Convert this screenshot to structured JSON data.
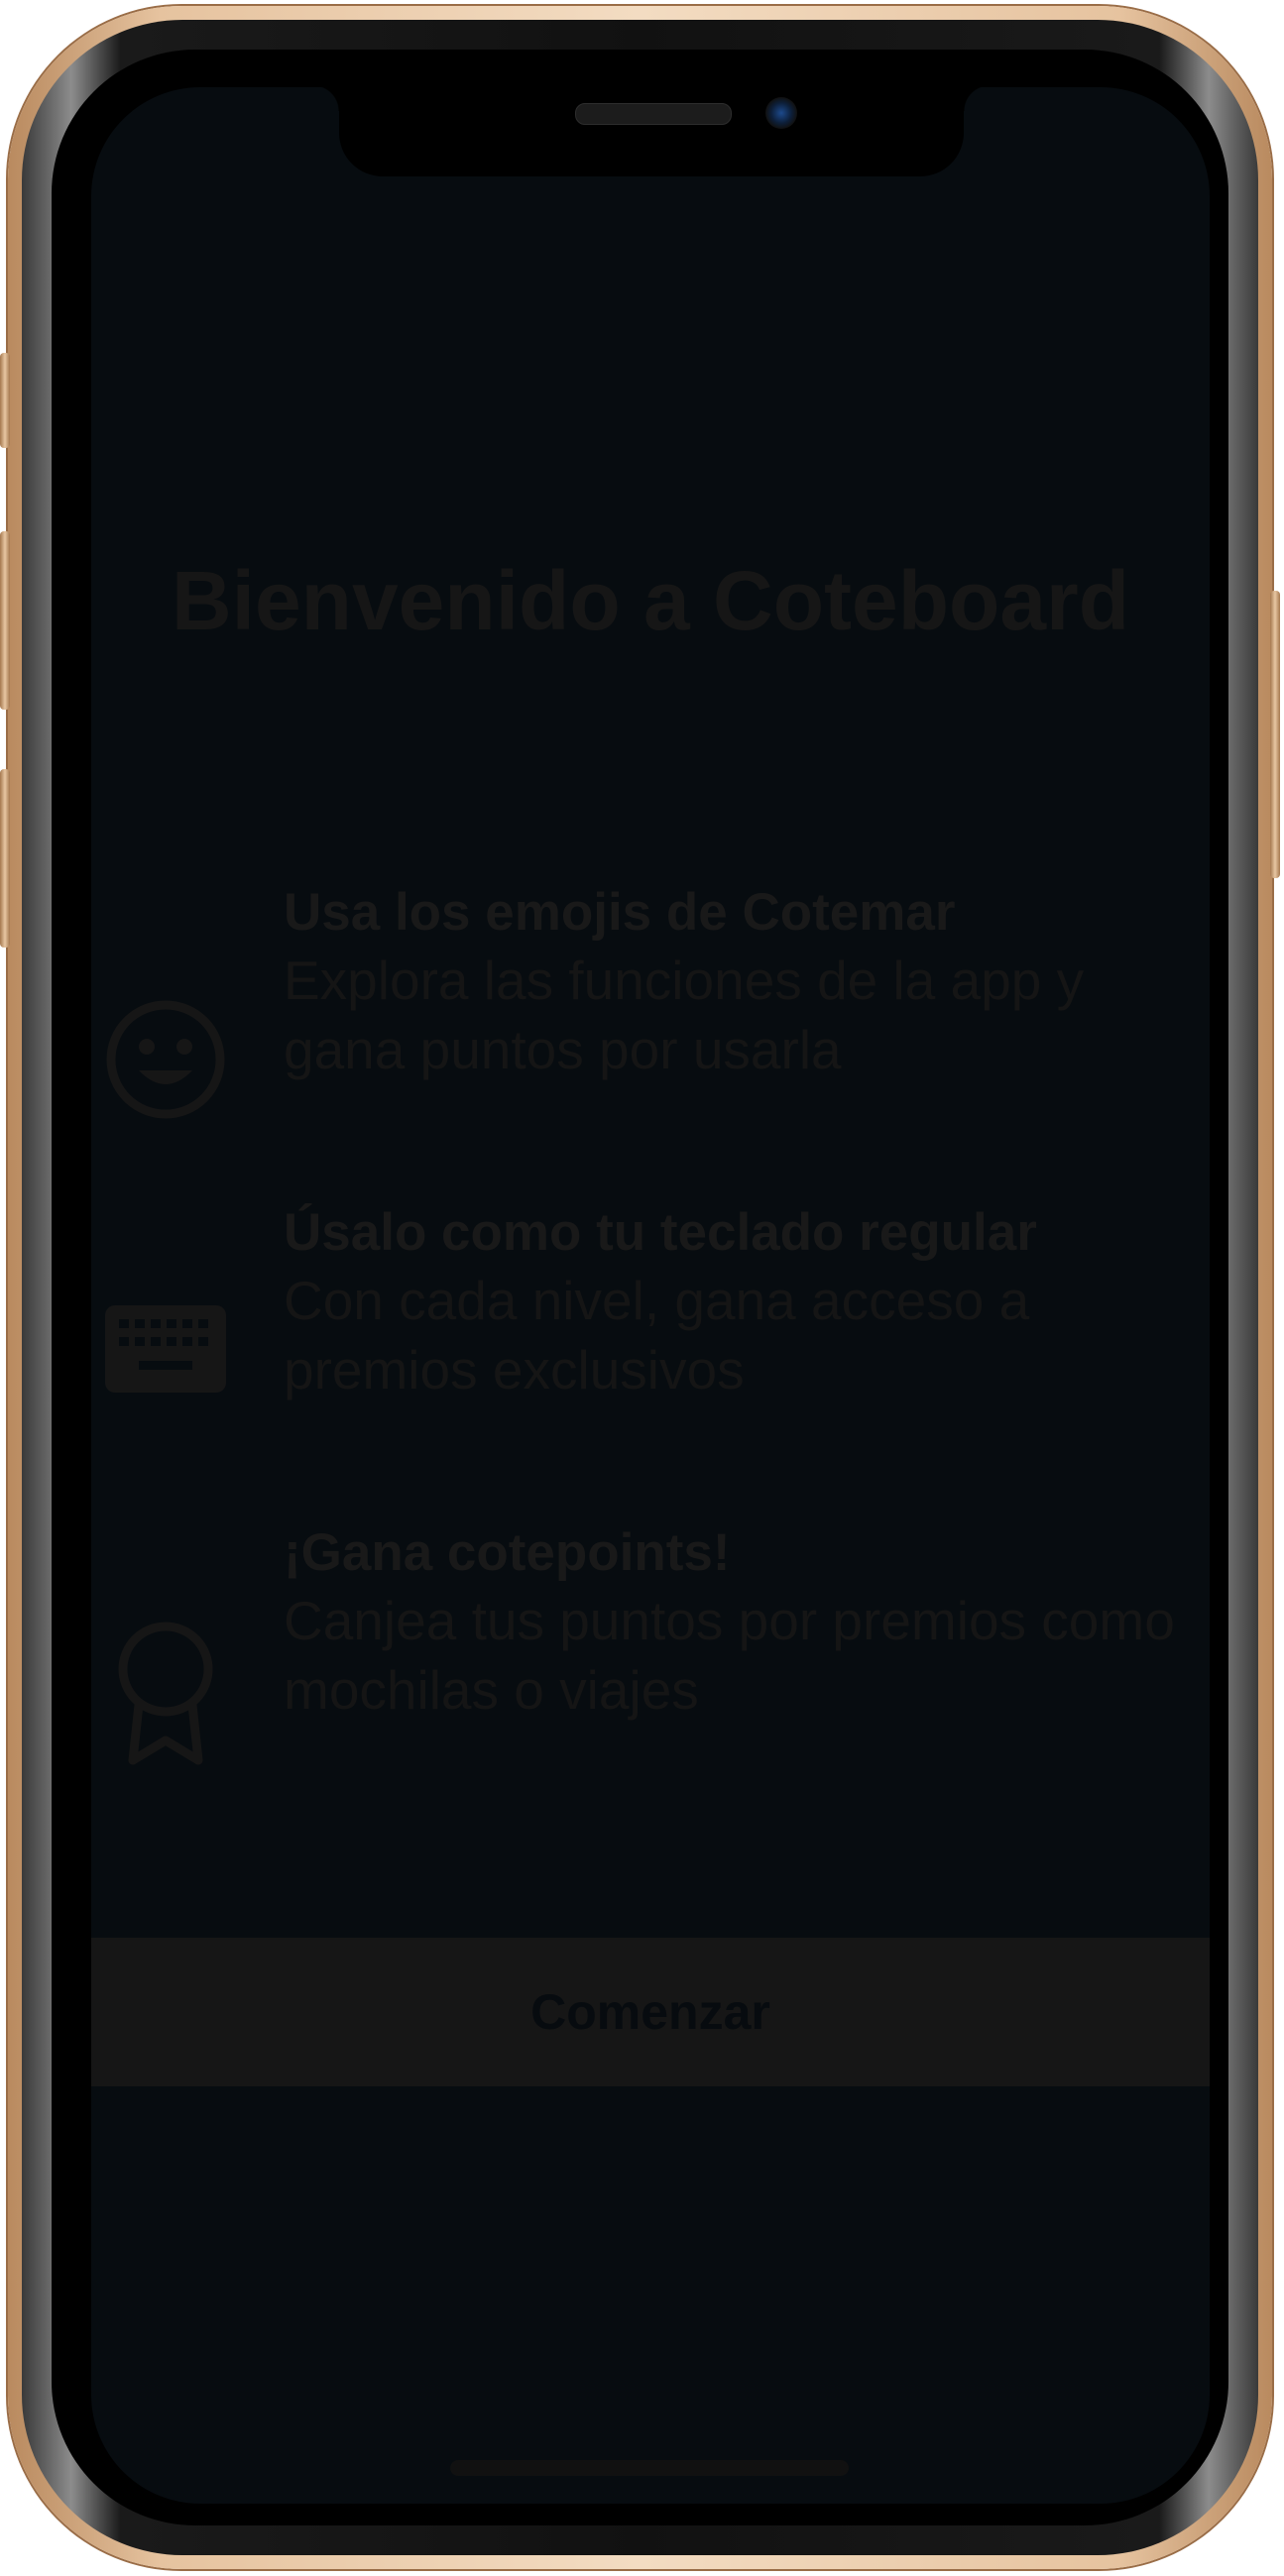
{
  "app": {
    "title": "Bienvenido a Coteboard"
  },
  "features": [
    {
      "icon": "smiley-face-icon",
      "heading": "Usa los emojis de Cotemar",
      "description": "Explora las funciones de la app y gana puntos por usarla"
    },
    {
      "icon": "keyboard-icon",
      "heading": "Úsalo como tu teclado regular",
      "description": "Con cada nivel, gana acceso a premios exclusivos"
    },
    {
      "icon": "award-ribbon-icon",
      "heading": "¡Gana cotepoints!",
      "description": "Canjea tus puntos por premios como mochilas o viajes"
    }
  ],
  "actions": {
    "start_label": "Comenzar"
  },
  "colors": {
    "background": "#070c10",
    "text_dim": "#171717",
    "button": "#161616",
    "frame_gold": "#e6c39f"
  }
}
